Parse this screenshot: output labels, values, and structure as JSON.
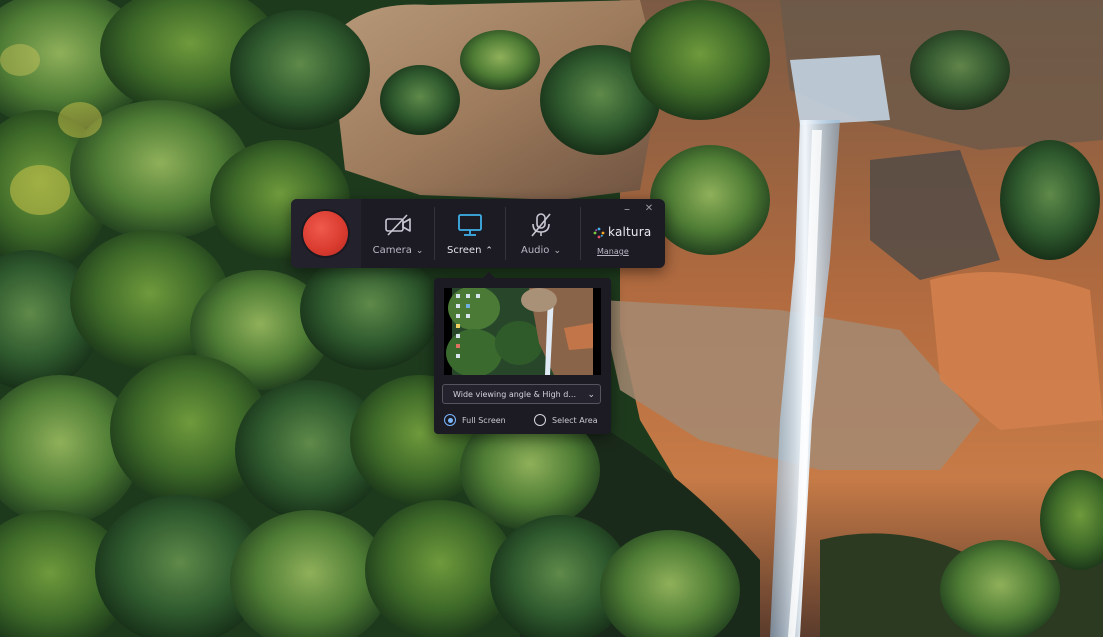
{
  "toolbar": {
    "record_button": "record",
    "camera_label": "Camera",
    "screen_label": "Screen",
    "audio_label": "Audio",
    "brand_name": "kaltura",
    "manage_label": "Manage",
    "minimize_glyph": "–",
    "close_glyph": "✕",
    "icons": {
      "camera": "camera-off-icon",
      "screen": "monitor-icon",
      "audio": "microphone-off-icon",
      "brand": "kaltura-logo-icon"
    }
  },
  "screen_panel": {
    "resolution_value": "Wide viewing angle & High d...",
    "options": [
      {
        "label": "Full Screen",
        "selected": true
      },
      {
        "label": "Select Area",
        "selected": false
      }
    ]
  },
  "colors": {
    "toolbar_bg": "#1c1b24",
    "record_red": "#d93a2e",
    "screen_active": "#3fb0e8",
    "radio_selected": "#7ab7ff"
  }
}
